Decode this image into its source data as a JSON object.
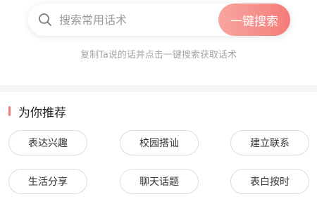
{
  "search": {
    "placeholder": "搜索常用话术",
    "button_label": "一键搜索",
    "hint": "复制Ta说的话并点击一键搜索获取话术"
  },
  "recommend": {
    "title": "为你推荐",
    "tags": [
      "表达兴趣",
      "校园搭讪",
      "建立联系",
      "生活分享",
      "聊天话题",
      "表白按时"
    ]
  },
  "colors": {
    "accent": "#f57c7a",
    "accent_light": "#f8a6a1"
  }
}
